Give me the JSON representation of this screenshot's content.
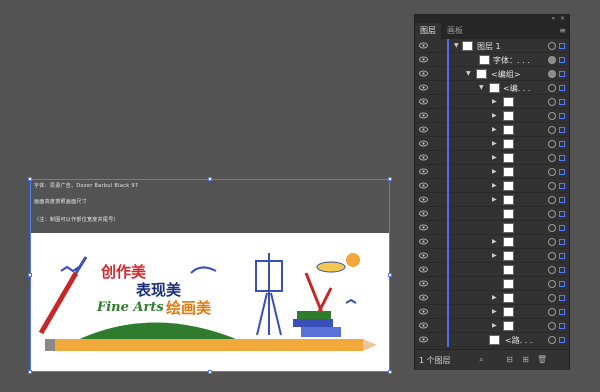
{
  "canvas": {
    "text_lines": [
      "字体：思源广告、Dozer Barbul Black 97",
      "画面高度按照画面尺寸",
      "（注：制图可以作部位宽度并尾号）"
    ],
    "artwork": {
      "title1": "创作美",
      "title2": "表现美",
      "title3": "绘画美",
      "title_en": "Fine Arts"
    }
  },
  "panel": {
    "collapse_icon": "«",
    "close_icon": "×",
    "tabs": [
      {
        "label": "图层"
      },
      {
        "label": "画板"
      }
    ],
    "menu_icon": "≡",
    "layer_count": "1 个图层",
    "layers": [
      {
        "name": "图层 1"
      },
      {
        "name": "字体：. . ."
      },
      {
        "name": "<编组>"
      },
      {
        "name": "<编. . ."
      },
      {
        "name": "<路. . ."
      }
    ],
    "bottom_icons": [
      "search-icon",
      "sublayer-icon",
      "new-layer-icon",
      "delete-icon"
    ]
  },
  "colors": {
    "accent_blue": "#4f7cff",
    "layer_color": "#4f6df5",
    "title_red": "#d6282b",
    "title_navy": "#1a2e7a",
    "title_green": "#2f7d2c",
    "title_orange": "#e07a12"
  }
}
